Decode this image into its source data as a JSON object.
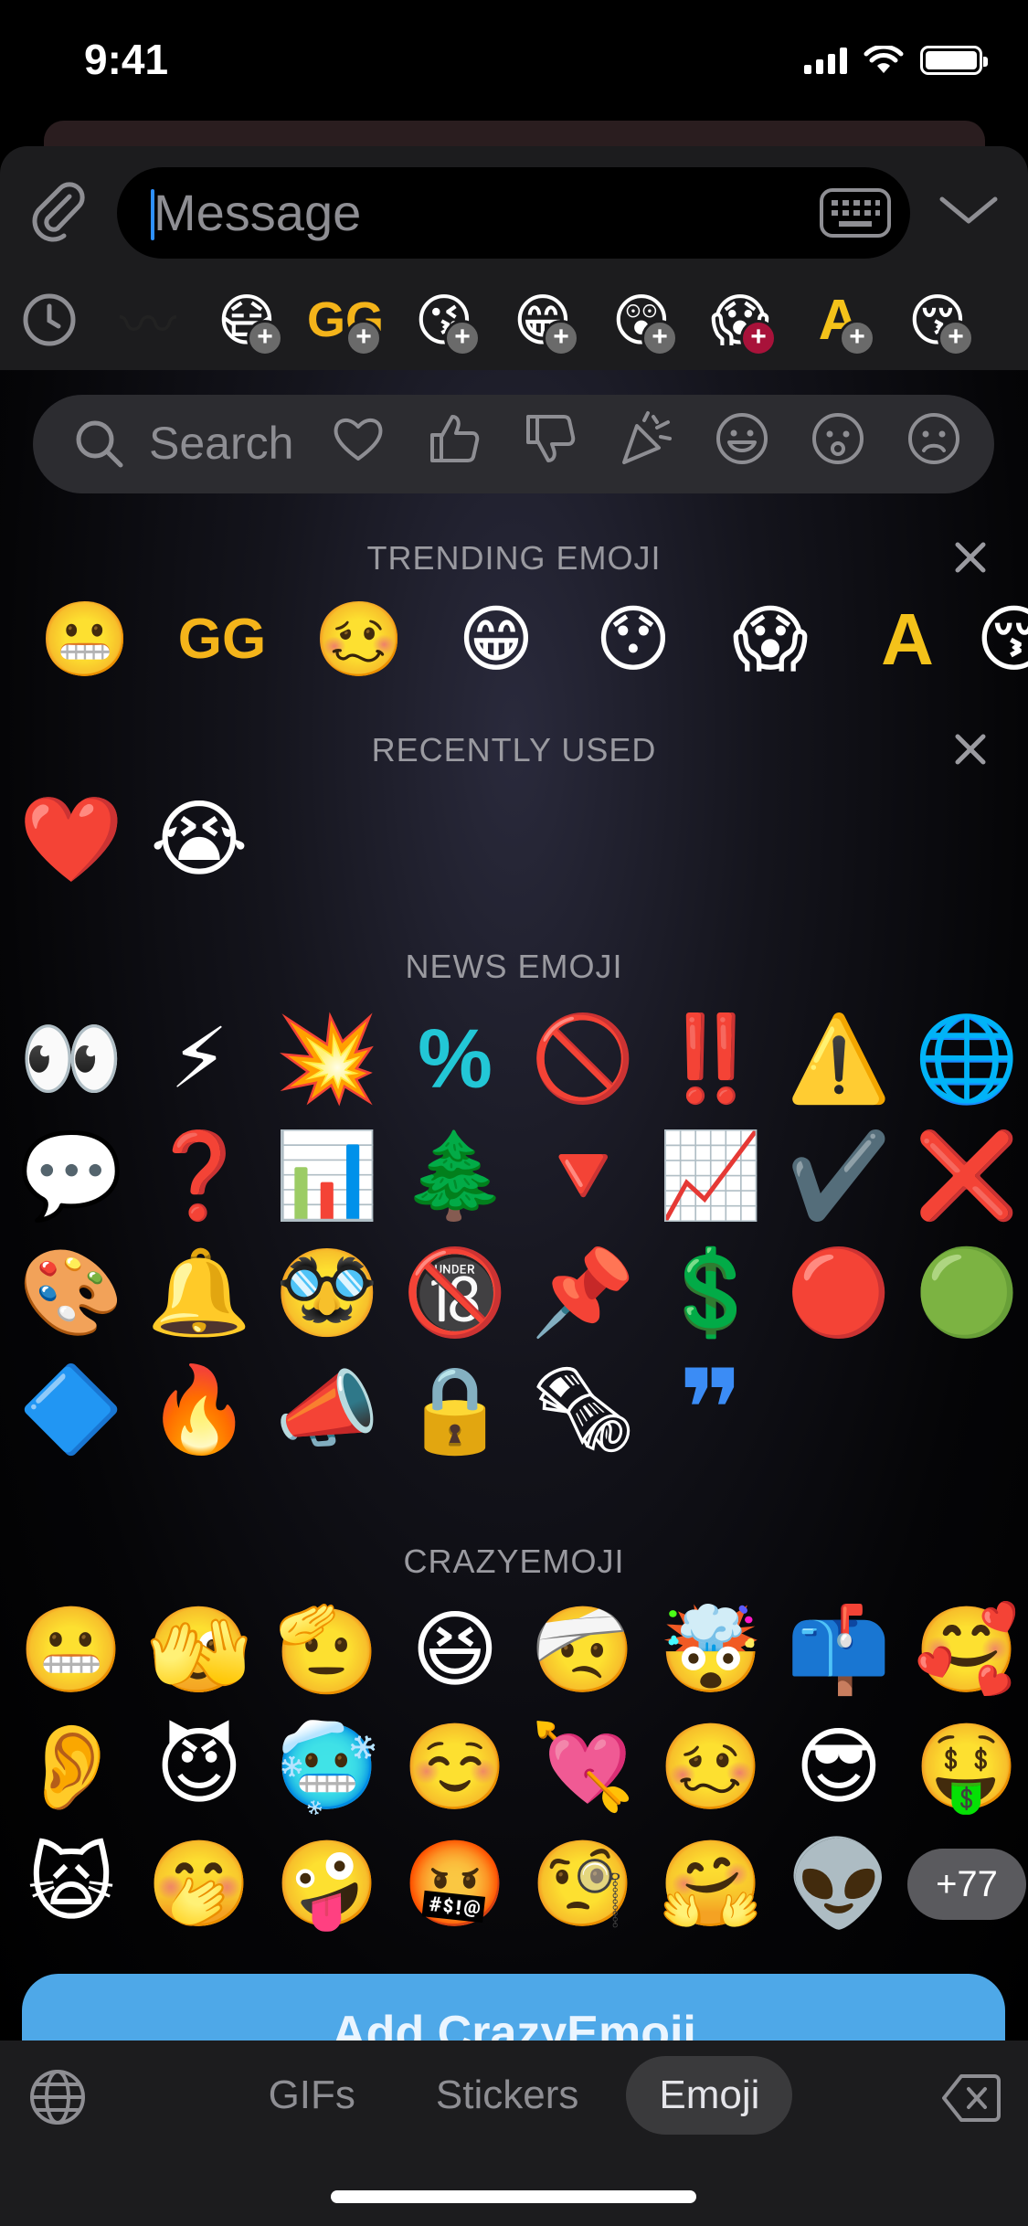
{
  "status": {
    "time": "9:41"
  },
  "input": {
    "placeholder": "Message"
  },
  "emoji_tabs": [
    {
      "icon": "recent-clock-icon",
      "glyph": ""
    },
    {
      "icon": "brow-emoji",
      "glyph": "〰"
    },
    {
      "icon": "mask-smile-emoji",
      "glyph": "😷"
    },
    {
      "icon": "gg-emoji",
      "glyph": "GG"
    },
    {
      "icon": "kiss-emoji",
      "glyph": "😘"
    },
    {
      "icon": "grin-emoji",
      "glyph": "😁"
    },
    {
      "icon": "surprise-emoji",
      "glyph": "😲"
    },
    {
      "icon": "ghost-emoji",
      "glyph": "😱"
    },
    {
      "icon": "letter-a-emoji",
      "glyph": "A"
    },
    {
      "icon": "blush-kiss-emoji",
      "glyph": "😚"
    }
  ],
  "search": {
    "placeholder": "Search"
  },
  "categories": [
    "heart-icon",
    "thumbs-up-icon",
    "thumbs-down-icon",
    "party-icon",
    "smile-icon",
    "frown-icon",
    "sad-icon"
  ],
  "sections": {
    "trending": {
      "title": "TRENDING EMOJI",
      "items": [
        "😬",
        "GG",
        "🥴",
        "😁",
        "😯",
        "😱",
        "A",
        "😚"
      ]
    },
    "recent": {
      "title": "RECENTLY USED",
      "items": [
        "❤️",
        "😭"
      ]
    },
    "news": {
      "title": "NEWS EMOJI",
      "rows": [
        [
          "👀",
          "⚡",
          "💥",
          "%",
          "🚫",
          "‼️",
          "⚠️",
          "🌐"
        ],
        [
          "💬",
          "❓",
          "📊",
          "🌲",
          "🔻",
          "📈",
          "✔️",
          "❌"
        ],
        [
          "🎨",
          "🔔",
          "🥸",
          "🔞",
          "📌",
          "💲",
          "🔴",
          "🟢"
        ],
        [
          "🔷",
          "🔥",
          "📣",
          "🔒",
          "🗞",
          "❞"
        ]
      ]
    },
    "crazy": {
      "title": "CRAZYEMOJI",
      "rows": [
        [
          "😬",
          "🫣",
          "🫡",
          "😆",
          "🤕",
          "🤯",
          "📫",
          "🥰"
        ],
        [
          "👂",
          "😈",
          "🥶",
          "☺️",
          "💘",
          "🥴",
          "😎",
          "🤑"
        ],
        [
          "🙀",
          "🤭",
          "🤪",
          "🤬",
          "🧐",
          "🤗",
          "👽"
        ]
      ],
      "more": "+77"
    }
  },
  "add_button": "Add CrazyEmoji",
  "bottom_tabs": [
    {
      "label": "GIFs",
      "active": false
    },
    {
      "label": "Stickers",
      "active": false
    },
    {
      "label": "Emoji",
      "active": true
    }
  ]
}
